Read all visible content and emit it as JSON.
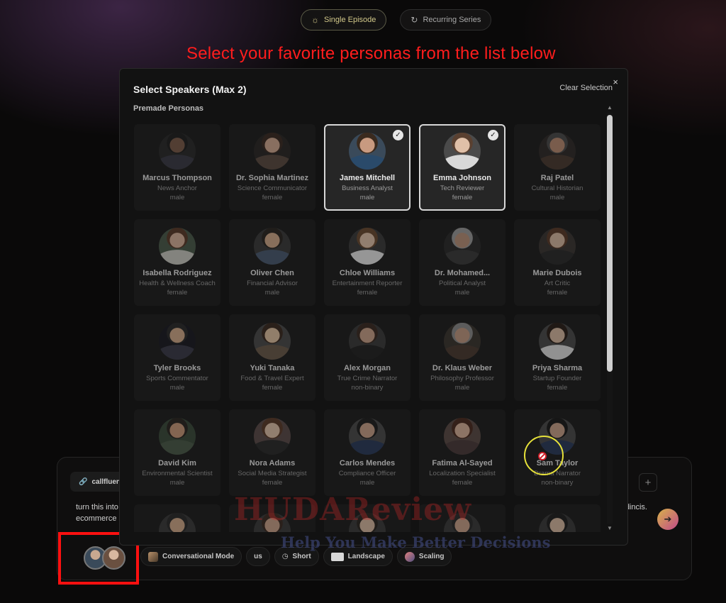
{
  "top_tabs": [
    {
      "label": "Single Episode",
      "icon": "sun-icon",
      "active": true
    },
    {
      "label": "Recurring Series",
      "icon": "refresh-icon",
      "active": false
    }
  ],
  "annotation": "Select your favorite personas from the list below",
  "modal": {
    "title": "Select Speakers (Max 2)",
    "clear_label": "Clear Selection",
    "close_label": "×",
    "section_label": "Premade Personas"
  },
  "personas": [
    {
      "name": "Marcus Thompson",
      "role": "News Anchor",
      "gender": "male",
      "selected": false
    },
    {
      "name": "Dr. Sophia Martinez",
      "role": "Science Communicator",
      "gender": "female",
      "selected": false
    },
    {
      "name": "James Mitchell",
      "role": "Business Analyst",
      "gender": "male",
      "selected": true
    },
    {
      "name": "Emma Johnson",
      "role": "Tech Reviewer",
      "gender": "female",
      "selected": true
    },
    {
      "name": "Raj Patel",
      "role": "Cultural Historian",
      "gender": "male",
      "selected": false
    },
    {
      "name": "Isabella Rodriguez",
      "role": "Health & Wellness Coach",
      "gender": "female",
      "selected": false
    },
    {
      "name": "Oliver Chen",
      "role": "Financial Advisor",
      "gender": "male",
      "selected": false
    },
    {
      "name": "Chloe Williams",
      "role": "Entertainment Reporter",
      "gender": "female",
      "selected": false
    },
    {
      "name": "Dr. Mohamed...",
      "role": "Political Analyst",
      "gender": "male",
      "selected": false
    },
    {
      "name": "Marie Dubois",
      "role": "Art Critic",
      "gender": "female",
      "selected": false
    },
    {
      "name": "Tyler Brooks",
      "role": "Sports Commentator",
      "gender": "male",
      "selected": false
    },
    {
      "name": "Yuki Tanaka",
      "role": "Food & Travel Expert",
      "gender": "female",
      "selected": false
    },
    {
      "name": "Alex Morgan",
      "role": "True Crime Narrator",
      "gender": "non-binary",
      "selected": false
    },
    {
      "name": "Dr. Klaus Weber",
      "role": "Philosophy Professor",
      "gender": "male",
      "selected": false
    },
    {
      "name": "Priya Sharma",
      "role": "Startup Founder",
      "gender": "female",
      "selected": false
    },
    {
      "name": "David Kim",
      "role": "Environmental Scientist",
      "gender": "male",
      "selected": false
    },
    {
      "name": "Nora Adams",
      "role": "Social Media Strategist",
      "gender": "female",
      "selected": false
    },
    {
      "name": "Carlos Mendes",
      "role": "Compliance Officer",
      "gender": "male",
      "selected": false
    },
    {
      "name": "Fatima Al-Sayed",
      "role": "Localization Specialist",
      "gender": "female",
      "selected": false
    },
    {
      "name": "Sam Taylor",
      "role": "Drama Narrator",
      "gender": "non-binary",
      "selected": false
    },
    {
      "name": "",
      "role": "",
      "gender": "",
      "selected": false
    },
    {
      "name": "",
      "role": "",
      "gender": "",
      "selected": false
    },
    {
      "name": "",
      "role": "",
      "gender": "",
      "selected": false
    },
    {
      "name": "",
      "role": "",
      "gender": "",
      "selected": false
    },
    {
      "name": "",
      "role": "",
      "gender": "",
      "selected": false
    }
  ],
  "composer": {
    "link_label": "callfluent.",
    "prompt_line1": "turn this into",
    "prompt_line2": "ecommerce",
    "prompt_right": "dincis.",
    "plus_label": "+",
    "send_icon": "arrow-right-icon"
  },
  "options": [
    {
      "label": "Conversational Mode",
      "icon": "mode-thumbnail-icon"
    },
    {
      "label": "us",
      "icon": ""
    },
    {
      "label": "Short",
      "icon": "clock-icon"
    },
    {
      "label": "Landscape",
      "icon": "landscape-icon"
    },
    {
      "label": "Scaling",
      "icon": "scaling-icon"
    }
  ],
  "watermark": {
    "title": "HUDAReview",
    "subtitle": "Help You Make Better Decisions"
  }
}
